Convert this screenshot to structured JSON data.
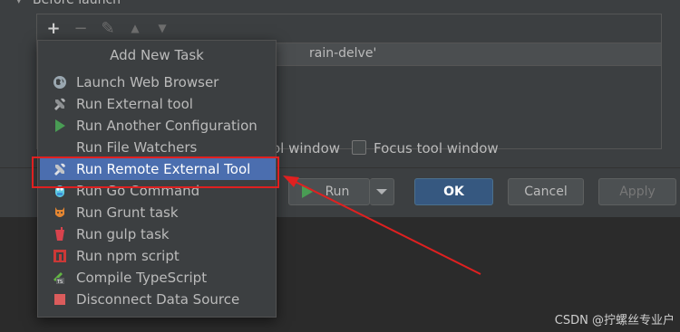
{
  "dialog": {
    "section_label": "Before launch",
    "task_row_text": "rain-delve'",
    "option_tool_window": "ol window",
    "option_focus_tool_window": "Focus tool window"
  },
  "toolbar": {
    "add": "+",
    "remove": "−",
    "edit": "✎",
    "up": "▲",
    "down": "▼"
  },
  "popup": {
    "title": "Add New Task",
    "items": [
      {
        "label": "Launch Web Browser",
        "icon": "globe-icon"
      },
      {
        "label": "Run External tool",
        "icon": "tools-icon"
      },
      {
        "label": "Run Another Configuration",
        "icon": "play-icon"
      },
      {
        "label": "Run File Watchers",
        "icon": ""
      },
      {
        "label": "Run Remote External Tool",
        "icon": "tools-icon"
      },
      {
        "label": "Run Go Command",
        "icon": "gopher-icon"
      },
      {
        "label": "Run Grunt task",
        "icon": "grunt-icon"
      },
      {
        "label": "Run gulp task",
        "icon": "gulp-icon"
      },
      {
        "label": "Run npm script",
        "icon": "npm-icon"
      },
      {
        "label": "Compile TypeScript",
        "icon": "typescript-icon"
      },
      {
        "label": "Disconnect Data Source",
        "icon": "stop-icon"
      }
    ],
    "selected_index": 4
  },
  "buttons": {
    "run": "Run",
    "ok": "OK",
    "cancel": "Cancel",
    "apply": "Apply"
  },
  "colors": {
    "selection": "#4b6eaf",
    "highlight_annotation": "#e02020",
    "ok_button": "#365880"
  },
  "watermark": "CSDN @拧螺丝专业户"
}
